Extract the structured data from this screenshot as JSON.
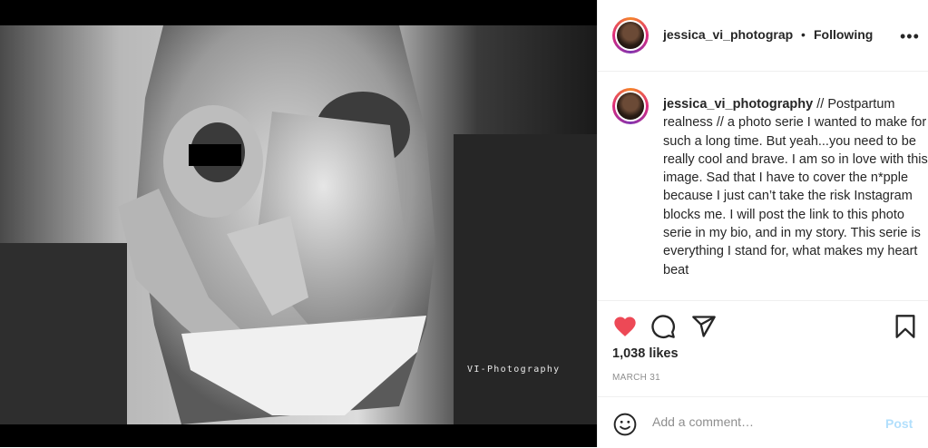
{
  "media": {
    "alt": "Black and white photo of a mother holding her newborn",
    "watermark": "VI-Photography"
  },
  "header": {
    "username": "jessica_vi_photograp",
    "separator": "•",
    "follow_status": "Following",
    "more_icon": "more-horizontal-icon"
  },
  "caption": {
    "username": "jessica_vi_photography",
    "text": " // Postpartum realness // a photo serie I wanted to make for such a long time. But yeah...you need to be really cool and brave. I am so in love with this image. Sad that I have to cover the n*pple because I just can’t take the risk Instagram blocks me. I will post the link to this photo serie in my bio, and in my story. This serie is everything I stand for, what makes my heart beat"
  },
  "actions": {
    "like_icon": "heart-filled-icon",
    "comment_icon": "comment-icon",
    "share_icon": "share-icon",
    "save_icon": "bookmark-icon",
    "like_color": "#ed4956"
  },
  "likes": "1,038 likes",
  "date": "MARCH 31",
  "add_comment": {
    "placeholder": "Add a comment…",
    "post_label": "Post",
    "emoji_icon": "emoji-icon"
  }
}
